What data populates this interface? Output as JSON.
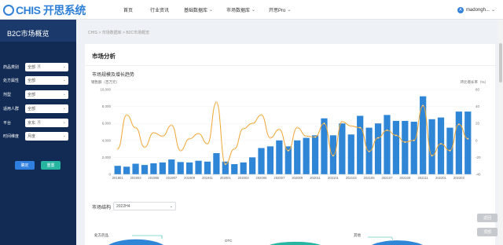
{
  "header": {
    "logo_text": "CHIS 开思系统",
    "nav": [
      {
        "label": "首页",
        "has_menu": false
      },
      {
        "label": "行业资讯",
        "has_menu": false
      },
      {
        "label": "基础数据库",
        "has_menu": true
      },
      {
        "label": "市场数据库",
        "has_menu": true
      },
      {
        "label": "开思Pro",
        "has_menu": true
      }
    ],
    "user": {
      "avatar": "A",
      "name": "madongh..."
    }
  },
  "sidebar": {
    "title": "B2C市场概览",
    "filters": [
      {
        "label": "药品类别",
        "value": "全部",
        "tag": "X"
      },
      {
        "label": "处方属性",
        "value": "全部",
        "tag": ""
      },
      {
        "label": "剂型",
        "value": "全部",
        "tag": ""
      },
      {
        "label": "适用人群",
        "value": "全部",
        "tag": ""
      },
      {
        "label": "平台",
        "value": "京东",
        "tag": "X"
      },
      {
        "label": "时间维度",
        "value": "月度",
        "tag": ""
      }
    ],
    "confirm_label": "确定",
    "reset_label": "重置",
    "colors": {
      "bg": "#122b55",
      "confirm": "#2f7fe0",
      "reset": "#26b5a0"
    }
  },
  "breadcrumb": "CHIS  >  市场数据库  >  B2C市场概览",
  "main": {
    "section_title": "市场分析",
    "chart_title": "市场规模及增长趋势",
    "structure_label": "市场结构",
    "structure_value": "2022H4",
    "pie_labels": [
      "处方药品",
      "OTC",
      "其他"
    ]
  },
  "side_buttons": [
    "返回",
    "顶部"
  ],
  "chart_data": {
    "type": "bar",
    "left_axis_label": "销售额（百万元）",
    "right_axis_label": "环比增长率（%）",
    "ylim": [
      0,
      10000
    ],
    "y2lim": [
      -40,
      60
    ],
    "y_ticks": [
      "10,000",
      "8,000",
      "6,000",
      "4,000",
      "2,000",
      "0"
    ],
    "y2_ticks": [
      "60",
      "40",
      "20",
      "0",
      "-20",
      "-40"
    ],
    "x_tick_labels": [
      "201901",
      "201903",
      "201905",
      "201907",
      "201909",
      "201911",
      "202001",
      "202003",
      "202005",
      "202007",
      "202009",
      "202011",
      "202101",
      "202103",
      "202105",
      "202107",
      "202109",
      "202111",
      "202201",
      "202203"
    ],
    "bar_color": "#2f86d6",
    "line_color": "#f0a532",
    "series": [
      {
        "type": "bar",
        "values": [
          1000,
          900,
          1250,
          1100,
          1300,
          1400,
          1750,
          1450,
          1400,
          1600,
          1500,
          2500,
          1500,
          1200,
          1400,
          2000,
          3100,
          3300,
          4000,
          3300,
          4000,
          4300,
          4600,
          6600,
          4600,
          6000,
          4700,
          6900,
          5500,
          6000,
          7000,
          6300,
          6300,
          6200,
          9200,
          6500,
          6700,
          5500,
          7400,
          7400
        ]
      },
      {
        "type": "line",
        "values": [
          -10,
          30,
          15,
          -8,
          9,
          5,
          18,
          -12,
          2,
          8,
          -4,
          45,
          -28,
          -10,
          14,
          20,
          30,
          3,
          13,
          -12,
          15,
          5,
          4,
          20,
          -18,
          22,
          17,
          15,
          -13,
          3,
          12,
          6,
          -2,
          0,
          41,
          -18,
          -4,
          -12,
          19,
          2
        ]
      }
    ]
  }
}
